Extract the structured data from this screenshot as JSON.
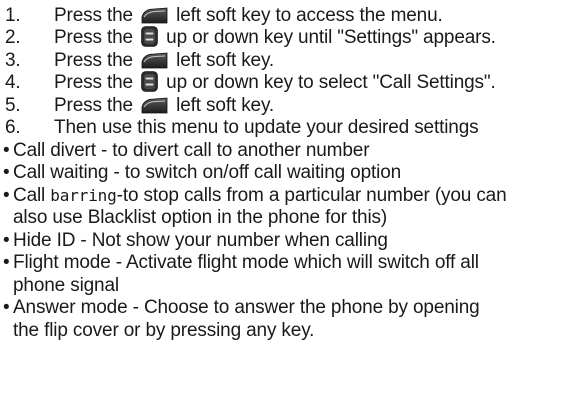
{
  "steps": [
    {
      "num": "1.",
      "pre": "Press the",
      "key": "left-soft-key-icon",
      "post": "left soft key to access the menu."
    },
    {
      "num": "2.",
      "pre": "Press the",
      "key": "up-down-key-icon",
      "post": "up or down key until \"Settings\" appears."
    },
    {
      "num": "3.",
      "pre": "Press the",
      "key": "left-soft-key-icon",
      "post": "left soft key."
    },
    {
      "num": "4.",
      "pre": "Press the",
      "key": "up-down-key-icon",
      "post": "up or down key to select \"Call Settings\"."
    },
    {
      "num": "5.",
      "pre": "Press the",
      "key": "left-soft-key-icon",
      "post": "left soft key."
    },
    {
      "num": "6.",
      "text": "Then use this menu to update your desired settings"
    }
  ],
  "bullet_symbol": "•",
  "bullets": [
    {
      "text": "Call divert - to divert call to another number"
    },
    {
      "text": "Call waiting - to switch on/off call waiting option"
    },
    {
      "pre": "Call ",
      "mono": "barring",
      "post": "-to stop calls from a particular number (you can"
    },
    {
      "cont": "also use Blacklist option in the phone for this)"
    },
    {
      "text": "Hide ID - Not show your number when calling"
    },
    {
      "text": "Flight mode - Activate flight mode which will switch off all"
    },
    {
      "cont": "phone signal"
    },
    {
      "text": "Answer mode - Choose to answer the phone by opening"
    },
    {
      "cont": "the flip cover or by pressing any key."
    }
  ],
  "colors": {
    "text": "#1a1a1a",
    "key_dark": "#2b2b2b",
    "key_light": "#e0e0e0"
  }
}
